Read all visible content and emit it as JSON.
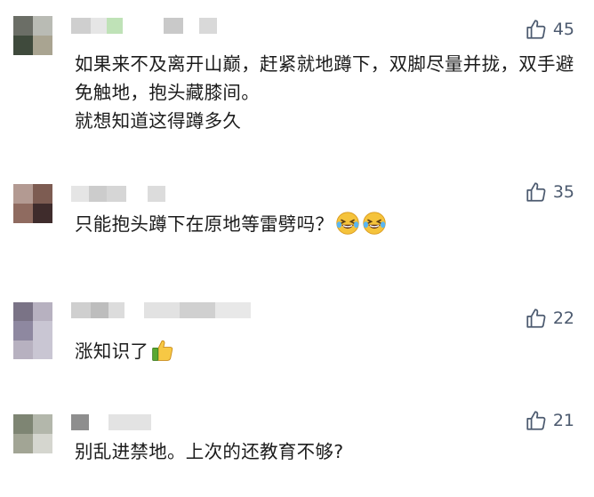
{
  "comments": [
    {
      "likes": "45",
      "lines": [
        "如果来不及离开山巅，赶紧就地蹲下，双脚尽量并拢，双手避免触地，抱头藏膝间。",
        "就想知道这得蹲多久"
      ],
      "avatar_colors": [
        "#6b6e66",
        "#b9bbb4",
        "#3f4a3c",
        "#a9a491"
      ],
      "name_mosaic_colors": [
        "#cfcfcf",
        "#e6e6e6",
        "#bfe2b7",
        "#ffffff",
        "#c9c9c9",
        "#ffffff",
        "#d9d9d9"
      ]
    },
    {
      "likes": "35",
      "lines": [
        "只能抱头蹲下在原地等雷劈吗？"
      ],
      "emoji": [
        "laugh-cry-emoji",
        "laugh-cry-emoji"
      ],
      "avatar_colors": [
        "#b39a92",
        "#7d5c52",
        "#8f6b60",
        "#3f2c2c"
      ],
      "name_mosaic_colors": [
        "#e5e5e5",
        "#cccccc",
        "#d6d6d6",
        "#ffffff",
        "#dcdcdc"
      ]
    },
    {
      "likes": "22",
      "lines": [
        "涨知识了"
      ],
      "emoji": [
        "thumbs-up-emoji"
      ],
      "avatar_colors": [
        "#7a7386",
        "#b7b1c0",
        "#8e88a0",
        "#c9c6d3"
      ],
      "name_mosaic_colors": [
        "#cfcfcf",
        "#bdbdbd",
        "#dcdcdc",
        "#ffffff",
        "#e2e2e2",
        "#d0d0d0",
        "#e8e8e8"
      ]
    },
    {
      "likes": "21",
      "lines": [
        "别乱进禁地。上次的还教育不够?"
      ],
      "avatar_colors": [
        "#7e8573",
        "#b3b7ab",
        "#a2a595",
        "#d5d6cf"
      ],
      "name_mosaic_colors": [
        "#8e8e8e",
        "#ffffff",
        "#e3e3e3"
      ]
    }
  ],
  "colors": {
    "like_count": "#4c5a6f",
    "text": "#1c1c1c"
  }
}
